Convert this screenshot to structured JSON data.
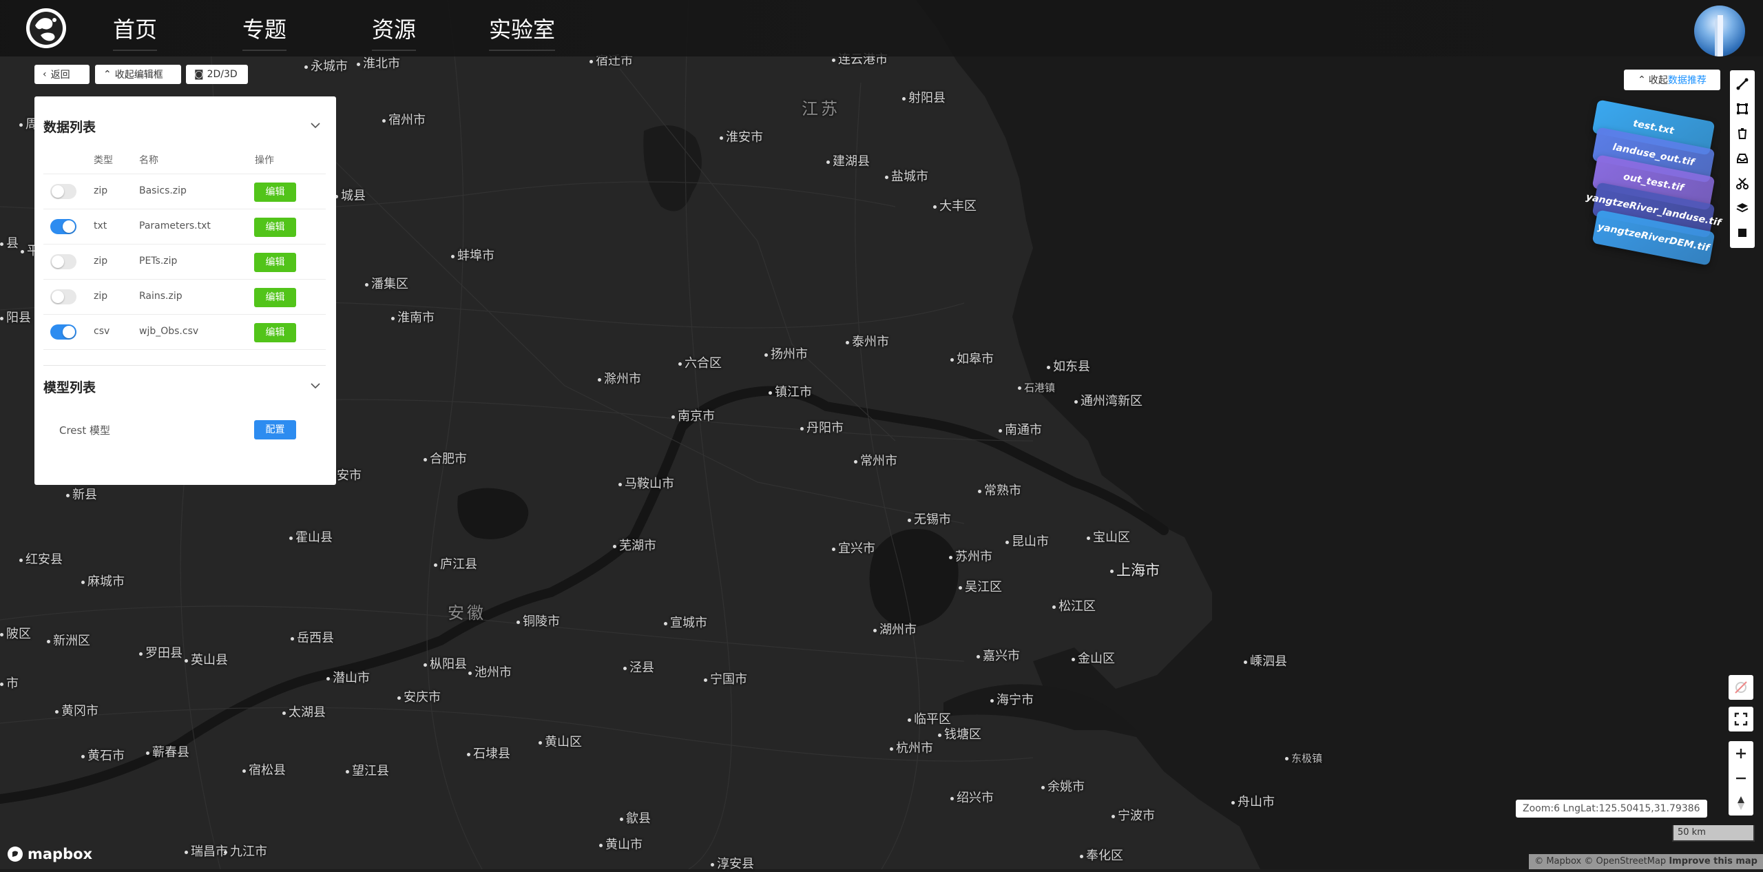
{
  "nav": {
    "items": [
      "首页",
      "专题",
      "资源",
      "实验室"
    ]
  },
  "panel_toolbar": {
    "back": "返回",
    "collapse_editor": "收起编辑框",
    "view_toggle": "2D/3D"
  },
  "data_list": {
    "title": "数据列表",
    "columns": [
      "类型",
      "名称",
      "操作"
    ],
    "rows": [
      {
        "enabled": false,
        "type": "zip",
        "name": "Basics.zip",
        "action": "编辑"
      },
      {
        "enabled": true,
        "type": "txt",
        "name": "Parameters.txt",
        "action": "编辑"
      },
      {
        "enabled": false,
        "type": "zip",
        "name": "PETs.zip",
        "action": "编辑"
      },
      {
        "enabled": false,
        "type": "zip",
        "name": "Rains.zip",
        "action": "编辑"
      },
      {
        "enabled": true,
        "type": "csv",
        "name": "wjb_Obs.csv",
        "action": "编辑"
      }
    ]
  },
  "model_list": {
    "title": "模型列表",
    "items": [
      {
        "name": "Crest 模型",
        "action": "配置"
      }
    ]
  },
  "recommend": {
    "collapse_label": "收起",
    "highlight_label": "数据推荐",
    "layers": [
      {
        "name": "test.txt",
        "color": "#3aa8f0"
      },
      {
        "name": "landuse_out.tif",
        "color": "#5b7ee8"
      },
      {
        "name": "out_test.tif",
        "color": "#8a6ce0"
      },
      {
        "name": "yangtzeRiver_landuse.tif",
        "color": "#4c57b8"
      },
      {
        "name": "yangtzeRiverDEM.tif",
        "color": "#3a9ae8"
      }
    ]
  },
  "right_toolbar": {
    "icons": [
      "line-draw-icon",
      "polygon-draw-icon",
      "trash-icon",
      "inbox-icon",
      "scissors-icon",
      "layers-icon",
      "square-icon"
    ]
  },
  "map_status": {
    "coords": "Zoom:6   LngLat:125.50415,31.79386",
    "scale": "50 km",
    "attribution": "© Mapbox © OpenStreetMap",
    "improve": "Improve this map",
    "brand": "mapbox"
  },
  "map_labels": [
    {
      "text": "永城市",
      "cls": ""
    },
    {
      "text": "淮北市",
      "cls": ""
    },
    {
      "text": "宿迁市",
      "cls": ""
    },
    {
      "text": "连云港市",
      "cls": ""
    },
    {
      "text": "射阳县",
      "cls": ""
    },
    {
      "text": "江苏",
      "cls": "region"
    },
    {
      "text": "宿州市",
      "cls": ""
    },
    {
      "text": "淮安市",
      "cls": ""
    },
    {
      "text": "建湖县",
      "cls": ""
    },
    {
      "text": "盐城市",
      "cls": ""
    },
    {
      "text": "周",
      "cls": ""
    },
    {
      "text": "大丰区",
      "cls": ""
    },
    {
      "text": "城县",
      "cls": ""
    },
    {
      "text": "蚌埠市",
      "cls": ""
    },
    {
      "text": "县",
      "cls": ""
    },
    {
      "text": "平",
      "cls": ""
    },
    {
      "text": "潘集区",
      "cls": ""
    },
    {
      "text": "淮南市",
      "cls": ""
    },
    {
      "text": "阳县",
      "cls": ""
    },
    {
      "text": "六合区",
      "cls": ""
    },
    {
      "text": "扬州市",
      "cls": ""
    },
    {
      "text": "泰州市",
      "cls": ""
    },
    {
      "text": "如皋市",
      "cls": ""
    },
    {
      "text": "如东县",
      "cls": ""
    },
    {
      "text": "滁州市",
      "cls": ""
    },
    {
      "text": "镇江市",
      "cls": ""
    },
    {
      "text": "石港镇",
      "cls": "small"
    },
    {
      "text": "通州湾新区",
      "cls": ""
    },
    {
      "text": "南京市",
      "cls": ""
    },
    {
      "text": "丹阳市",
      "cls": ""
    },
    {
      "text": "南通市",
      "cls": ""
    },
    {
      "text": "合肥市",
      "cls": ""
    },
    {
      "text": "常州市",
      "cls": ""
    },
    {
      "text": "安市",
      "cls": ""
    },
    {
      "text": "马鞍山市",
      "cls": ""
    },
    {
      "text": "常熟市",
      "cls": ""
    },
    {
      "text": "新县",
      "cls": ""
    },
    {
      "text": "无锡市",
      "cls": ""
    },
    {
      "text": "霍山县",
      "cls": ""
    },
    {
      "text": "芜湖市",
      "cls": ""
    },
    {
      "text": "宜兴市",
      "cls": ""
    },
    {
      "text": "苏州市",
      "cls": ""
    },
    {
      "text": "昆山市",
      "cls": ""
    },
    {
      "text": "宝山区",
      "cls": ""
    },
    {
      "text": "红安县",
      "cls": ""
    },
    {
      "text": "庐江县",
      "cls": ""
    },
    {
      "text": "上海市",
      "cls": "big"
    },
    {
      "text": "麻城市",
      "cls": ""
    },
    {
      "text": "吴江区",
      "cls": ""
    },
    {
      "text": "安徽",
      "cls": "region"
    },
    {
      "text": "铜陵市",
      "cls": ""
    },
    {
      "text": "宣城市",
      "cls": ""
    },
    {
      "text": "松江区",
      "cls": ""
    },
    {
      "text": "湖州市",
      "cls": ""
    },
    {
      "text": "陂区",
      "cls": ""
    },
    {
      "text": "新洲区",
      "cls": ""
    },
    {
      "text": "岳西县",
      "cls": ""
    },
    {
      "text": "罗田县",
      "cls": ""
    },
    {
      "text": "英山县",
      "cls": ""
    },
    {
      "text": "嘉兴市",
      "cls": ""
    },
    {
      "text": "金山区",
      "cls": ""
    },
    {
      "text": "嵊泗县",
      "cls": ""
    },
    {
      "text": "枞阳县",
      "cls": ""
    },
    {
      "text": "泾县",
      "cls": ""
    },
    {
      "text": "池州市",
      "cls": ""
    },
    {
      "text": "宁国市",
      "cls": ""
    },
    {
      "text": "市",
      "cls": ""
    },
    {
      "text": "潜山市",
      "cls": ""
    },
    {
      "text": "安庆市",
      "cls": ""
    },
    {
      "text": "海宁市",
      "cls": ""
    },
    {
      "text": "黄冈市",
      "cls": ""
    },
    {
      "text": "太湖县",
      "cls": ""
    },
    {
      "text": "临平区",
      "cls": ""
    },
    {
      "text": "黄山区",
      "cls": ""
    },
    {
      "text": "钱塘区",
      "cls": ""
    },
    {
      "text": "杭州市",
      "cls": ""
    },
    {
      "text": "黄石市",
      "cls": ""
    },
    {
      "text": "蕲春县",
      "cls": ""
    },
    {
      "text": "石埭县",
      "cls": ""
    },
    {
      "text": "东极镇",
      "cls": "small"
    },
    {
      "text": "宿松县",
      "cls": ""
    },
    {
      "text": "望江县",
      "cls": ""
    },
    {
      "text": "余姚市",
      "cls": ""
    },
    {
      "text": "绍兴市",
      "cls": ""
    },
    {
      "text": "舟山市",
      "cls": ""
    },
    {
      "text": "歙县",
      "cls": ""
    },
    {
      "text": "宁波市",
      "cls": ""
    },
    {
      "text": "瑞昌市",
      "cls": ""
    },
    {
      "text": "九江市",
      "cls": ""
    },
    {
      "text": "黄山市",
      "cls": ""
    },
    {
      "text": "奉化区",
      "cls": ""
    },
    {
      "text": "淳安县",
      "cls": ""
    }
  ]
}
